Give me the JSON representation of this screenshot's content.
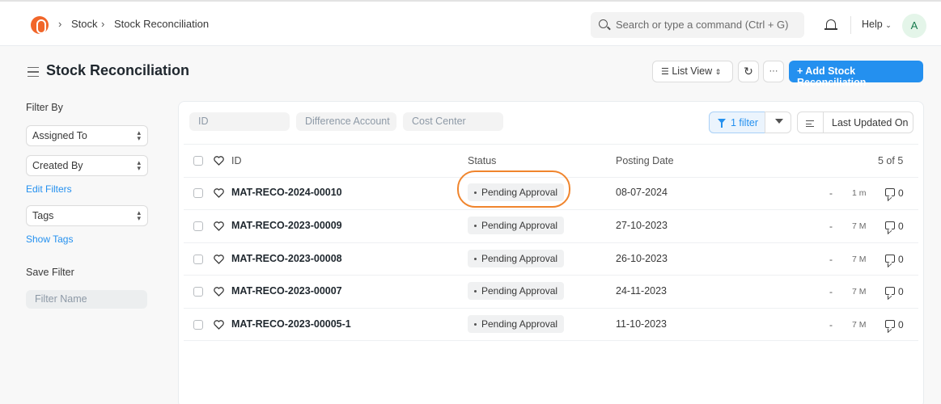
{
  "navbar": {
    "breadcrumbs": [
      "Stock",
      "Stock Reconciliation"
    ],
    "search_placeholder": "Search or type a command (Ctrl + G)",
    "help_label": "Help",
    "avatar_initial": "A"
  },
  "page": {
    "title": "Stock Reconciliation",
    "list_view_label": "List View",
    "more_label": "···",
    "add_button_label": "+ Add Stock Reconciliation"
  },
  "sidebar": {
    "filter_by_label": "Filter By",
    "assigned_to_label": "Assigned To",
    "created_by_label": "Created By",
    "edit_filters_label": "Edit Filters",
    "tags_label": "Tags",
    "show_tags_label": "Show Tags",
    "save_filter_label": "Save Filter",
    "filter_name_placeholder": "Filter Name"
  },
  "filters": {
    "id_placeholder": "ID",
    "difference_account_placeholder": "Difference Account",
    "cost_center_placeholder": "Cost Center",
    "filter_button_label": "1 filter",
    "sort_label": "Last Updated On"
  },
  "table": {
    "columns": {
      "id": "ID",
      "status": "Status",
      "posting_date": "Posting Date"
    },
    "count_label": "5 of 5",
    "rows": [
      {
        "id": "MAT-RECO-2024-00010",
        "status": "Pending Approval",
        "posting_date": "08-07-2024",
        "dash": "-",
        "age": "1 m",
        "comments": "0"
      },
      {
        "id": "MAT-RECO-2023-00009",
        "status": "Pending Approval",
        "posting_date": "27-10-2023",
        "dash": "-",
        "age": "7 M",
        "comments": "0"
      },
      {
        "id": "MAT-RECO-2023-00008",
        "status": "Pending Approval",
        "posting_date": "26-10-2023",
        "dash": "-",
        "age": "7 M",
        "comments": "0"
      },
      {
        "id": "MAT-RECO-2023-00007",
        "status": "Pending Approval",
        "posting_date": "24-11-2023",
        "dash": "-",
        "age": "7 M",
        "comments": "0"
      },
      {
        "id": "MAT-RECO-2023-00005-1",
        "status": "Pending Approval",
        "posting_date": "11-10-2023",
        "dash": "-",
        "age": "7 M",
        "comments": "0"
      }
    ]
  },
  "colors": {
    "primary": "#2490ef",
    "brand": "#f1662a",
    "highlight_annotation": "#f0852d"
  },
  "icons": [
    "app-logo-icon",
    "chevron-right-icon",
    "search-icon",
    "bell-icon",
    "chevron-down-icon",
    "hamburger-icon",
    "list-icon",
    "refresh-icon",
    "filter-icon",
    "clear-filter-icon",
    "sort-icon",
    "heart-icon",
    "comment-icon",
    "select-arrows-icon"
  ]
}
